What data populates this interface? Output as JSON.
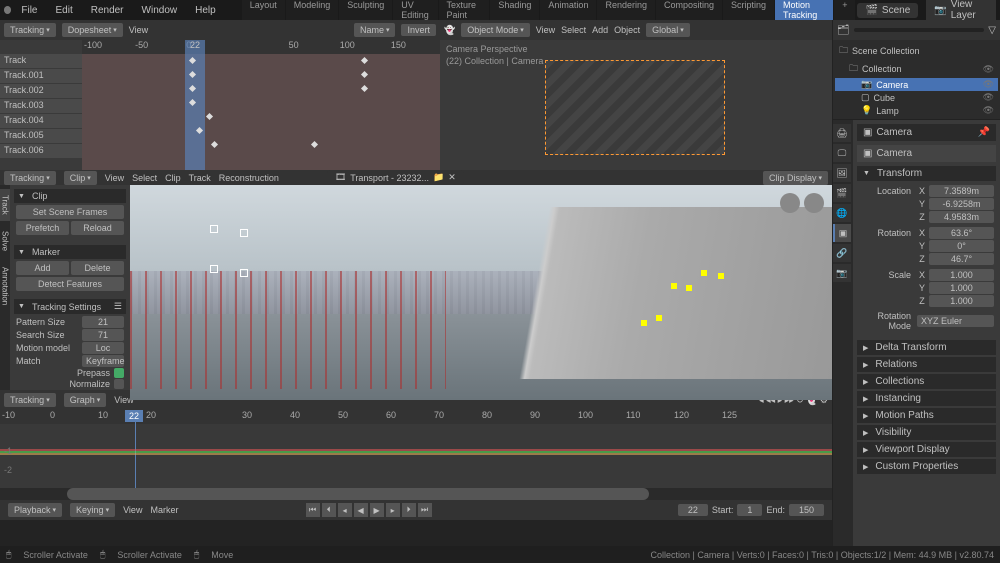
{
  "topbar": {
    "menus": [
      "File",
      "Edit",
      "Render",
      "Window",
      "Help"
    ],
    "workspaces": [
      "Layout",
      "Modeling",
      "Sculpting",
      "UV Editing",
      "Texture Paint",
      "Shading",
      "Animation",
      "Rendering",
      "Compositing",
      "Scripting",
      "Motion Tracking",
      "+"
    ],
    "active_workspace": "Motion Tracking",
    "scene": "Scene",
    "view_layer": "View Layer"
  },
  "dopesheet": {
    "header": {
      "tracking": "Tracking",
      "mode": "Dopesheet",
      "view": "View"
    },
    "ruler": [
      "-100",
      "-50",
      "0",
      "22",
      "50",
      "100",
      "150"
    ],
    "playhead_frame": "22",
    "tracks": [
      "Track",
      "Track.001",
      "Track.002",
      "Track.003",
      "Track.004",
      "Track.005",
      "Track.006"
    ]
  },
  "view3d": {
    "header": {
      "mode": "Object Mode",
      "view": "View",
      "select": "Select",
      "add": "Add",
      "object": "Object",
      "global": "Global"
    },
    "overlay_line1": "Camera Perspective",
    "overlay_line2": "(22) Collection | Camera",
    "name_field": "Name",
    "invert": "Invert"
  },
  "clip": {
    "header": {
      "tracking": "Tracking",
      "mode": "Clip",
      "view": "View",
      "select": "Select",
      "clip": "Clip",
      "track": "Track",
      "reconstruction": "Reconstruction",
      "filename": "Transport - 23232...",
      "display": "Clip Display"
    },
    "side_tabs": [
      "Track",
      "Solve",
      "Annotation"
    ],
    "panel_clip": {
      "title": "Clip",
      "set_scene": "Set Scene Frames",
      "prefetch": "Prefetch",
      "reload": "Reload"
    },
    "panel_marker": {
      "title": "Marker",
      "add": "Add",
      "delete": "Delete",
      "detect": "Detect Features"
    },
    "panel_tracking": {
      "title": "Tracking Settings",
      "pattern_size": {
        "label": "Pattern Size",
        "value": "21"
      },
      "search_size": {
        "label": "Search Size",
        "value": "71"
      },
      "motion_model": {
        "label": "Motion model",
        "value": "Loc"
      },
      "match": {
        "label": "Match",
        "value": "Keyframe"
      },
      "prepass": "Prepass",
      "normalize": "Normalize"
    }
  },
  "graph": {
    "header": {
      "tracking": "Tracking",
      "mode": "Graph",
      "view": "View"
    },
    "ruler": [
      "-10",
      "0",
      "10",
      "20",
      "22",
      "30",
      "40",
      "50",
      "60",
      "70",
      "80",
      "90",
      "100",
      "110",
      "120",
      "125"
    ],
    "y_ticks": [
      "-1",
      "-2"
    ],
    "footer": {
      "playback": "Playback",
      "keying": "Keying",
      "view": "View",
      "marker": "Marker",
      "frame": "22",
      "start_lbl": "Start:",
      "start": "1",
      "end_lbl": "End:",
      "end": "150"
    }
  },
  "outliner": {
    "scene_collection": "Scene Collection",
    "collection": "Collection",
    "items": [
      {
        "name": "Camera",
        "selected": true
      },
      {
        "name": "Cube",
        "selected": false
      },
      {
        "name": "Lamp",
        "selected": false
      }
    ]
  },
  "props": {
    "header_bread": "Camera",
    "item_name": "Camera",
    "transform": {
      "title": "Transform",
      "location": {
        "label": "Location",
        "x": "7.3589m",
        "y": "-6.9258m",
        "z": "4.9583m"
      },
      "rotation": {
        "label": "Rotation",
        "x": "63.6°",
        "y": "0°",
        "z": "46.7°"
      },
      "scale": {
        "label": "Scale",
        "x": "1.000",
        "y": "1.000",
        "z": "1.000"
      },
      "rotation_mode": {
        "label": "Rotation Mode",
        "value": "XYZ Euler"
      }
    },
    "panels": [
      "Delta Transform",
      "Relations",
      "Collections",
      "Instancing",
      "Motion Paths",
      "Visibility",
      "Viewport Display",
      "Custom Properties"
    ]
  },
  "status": {
    "scroller1": "Scroller Activate",
    "scroller2": "Scroller Activate",
    "move": "Move",
    "right": "Collection | Camera | Verts:0 | Faces:0 | Tris:0 | Objects:1/2 | Mem: 44.9 MB | v2.80.74"
  }
}
